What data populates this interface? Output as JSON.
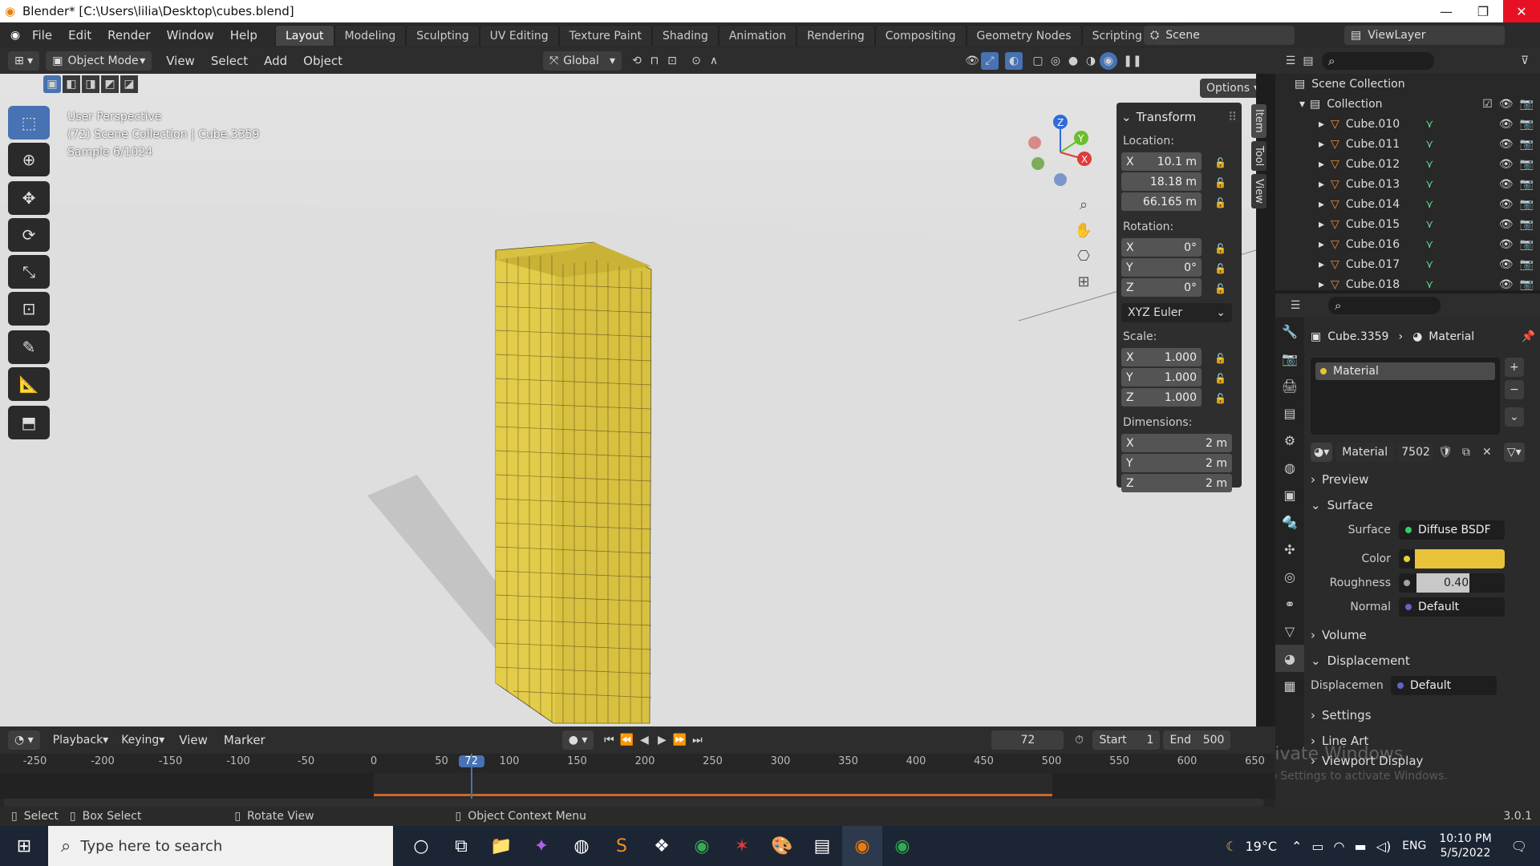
{
  "window": {
    "title": "Blender* [C:\\Users\\lilia\\Desktop\\cubes.blend]",
    "minimize": "—",
    "restore": "❐",
    "close": "✕"
  },
  "menu": {
    "items": [
      "File",
      "Edit",
      "Render",
      "Window",
      "Help"
    ]
  },
  "workspaces": [
    "Layout",
    "Modeling",
    "Sculpting",
    "UV Editing",
    "Texture Paint",
    "Shading",
    "Animation",
    "Rendering",
    "Compositing",
    "Geometry Nodes",
    "Scripting",
    "+"
  ],
  "scene": {
    "name": "Scene",
    "view_layer": "ViewLayer"
  },
  "viewport_header": {
    "mode": "Object Mode",
    "menus": [
      "View",
      "Select",
      "Add",
      "Object"
    ],
    "orientation": "Global",
    "options": "Options"
  },
  "viewport": {
    "perspective": "User Perspective",
    "collection_info": "(72) Scene Collection | Cube.3359",
    "sample": "Sample 6/1024",
    "gizmo": {
      "x": "X",
      "y": "Y",
      "z": "Z"
    }
  },
  "transform": {
    "title": "Transform",
    "location_label": "Location:",
    "location": [
      {
        "a": "X",
        "v": "10.1 m"
      },
      {
        "a": "",
        "v": "18.18 m"
      },
      {
        "a": "",
        "v": "66.165 m"
      }
    ],
    "rotation_label": "Rotation:",
    "rotation": [
      {
        "a": "X",
        "v": "0°"
      },
      {
        "a": "Y",
        "v": "0°"
      },
      {
        "a": "Z",
        "v": "0°"
      }
    ],
    "rotation_mode": "XYZ Euler",
    "scale_label": "Scale:",
    "scale": [
      {
        "a": "X",
        "v": "1.000"
      },
      {
        "a": "Y",
        "v": "1.000"
      },
      {
        "a": "Z",
        "v": "1.000"
      }
    ],
    "dimensions_label": "Dimensions:",
    "dimensions": [
      {
        "a": "X",
        "v": "2 m"
      },
      {
        "a": "Y",
        "v": "2 m"
      },
      {
        "a": "Z",
        "v": "2 m"
      }
    ]
  },
  "npanel_tabs": [
    "Item",
    "Tool",
    "View"
  ],
  "outliner": {
    "root": "Scene Collection",
    "collection": "Collection",
    "objects": [
      "Cube.010",
      "Cube.011",
      "Cube.012",
      "Cube.013",
      "Cube.014",
      "Cube.015",
      "Cube.016",
      "Cube.017",
      "Cube.018"
    ]
  },
  "properties": {
    "object": "Cube.3359",
    "context": "Material",
    "slot": "Material",
    "material_name": "Material",
    "users": "7502",
    "sections": {
      "preview": "Preview",
      "surface": "Surface",
      "volume": "Volume",
      "displacement": "Displacement",
      "settings": "Settings",
      "line_art": "Line Art",
      "viewport_display": "Viewport Display"
    },
    "surface_label": "Surface",
    "surface_value": "Diffuse BSDF",
    "color_label": "Color",
    "color_hex": "#e8c33a",
    "roughness_label": "Roughness",
    "roughness_value": "0.400",
    "roughness_fraction": 0.4,
    "normal_label": "Normal",
    "normal_value": "Default",
    "displacement_label": "Displacemen",
    "displacement_value": "Default",
    "watermark": "Activate Windows",
    "watermark_sub": "Go to Settings to activate Windows."
  },
  "timeline": {
    "menus": [
      "Playback",
      "Keying",
      "View",
      "Marker"
    ],
    "current_frame": "72",
    "start_label": "Start",
    "start": "1",
    "end_label": "End",
    "end": "500",
    "ticks": [
      "-250",
      "-200",
      "-150",
      "-100",
      "-50",
      "0",
      "50",
      "72",
      "100",
      "150",
      "200",
      "250",
      "300",
      "350",
      "400",
      "450",
      "500",
      "550",
      "600",
      "650"
    ]
  },
  "status": {
    "select": "Select",
    "box_select": "Box Select",
    "rotate_view": "Rotate View",
    "context_menu": "Object Context Menu",
    "version": "3.0.1"
  },
  "taskbar": {
    "search_placeholder": "Type here to search",
    "weather": "19°C",
    "lang": "ENG",
    "time": "10:10 PM",
    "date": "5/5/2022"
  }
}
